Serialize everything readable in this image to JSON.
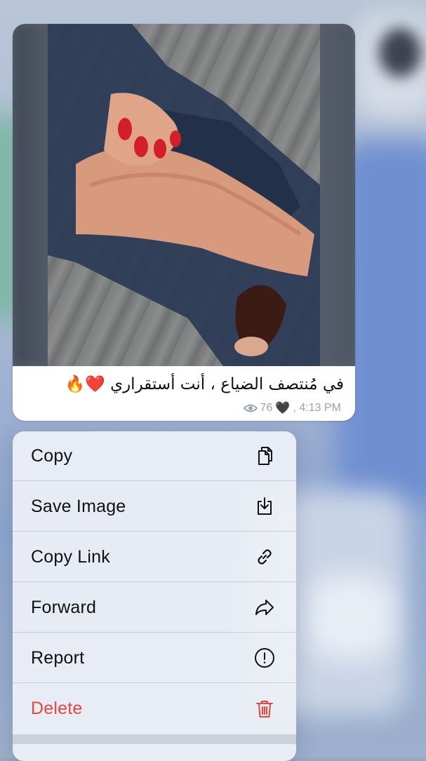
{
  "message": {
    "caption": "في مُنتصف الضياع ، أنت أستقراري ❤️🔥",
    "views": "76",
    "reaction": "🖤",
    "time": ", 4:13 PM",
    "view_icon": "eye-icon"
  },
  "menu": {
    "items": [
      {
        "label": "Copy",
        "icon": "copy-icon"
      },
      {
        "label": "Save Image",
        "icon": "download-icon"
      },
      {
        "label": "Copy Link",
        "icon": "link-icon"
      },
      {
        "label": "Forward",
        "icon": "forward-arrow-icon"
      },
      {
        "label": "Report",
        "icon": "exclamation-circle-icon"
      },
      {
        "label": "Delete",
        "icon": "trash-icon",
        "color": "#e8453c"
      }
    ]
  },
  "colors": {
    "danger": "#e8453c",
    "meta_text": "#9aa3ad"
  }
}
